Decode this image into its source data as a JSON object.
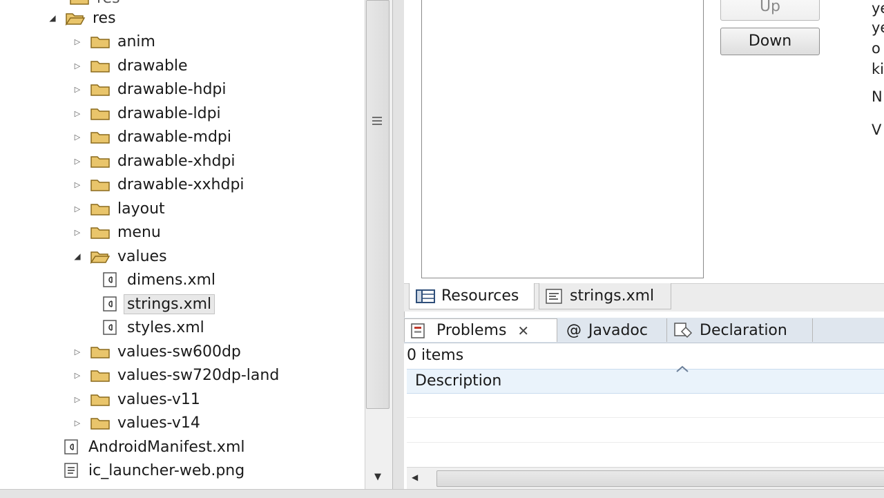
{
  "explorer": {
    "top_partial_label": "res",
    "items": [
      {
        "label": "res",
        "kind": "folder",
        "state": "open"
      },
      {
        "label": "anim",
        "kind": "folder",
        "state": "closed"
      },
      {
        "label": "drawable",
        "kind": "folder",
        "state": "closed"
      },
      {
        "label": "drawable-hdpi",
        "kind": "folder",
        "state": "closed"
      },
      {
        "label": "drawable-ldpi",
        "kind": "folder",
        "state": "closed"
      },
      {
        "label": "drawable-mdpi",
        "kind": "folder",
        "state": "closed"
      },
      {
        "label": "drawable-xhdpi",
        "kind": "folder",
        "state": "closed"
      },
      {
        "label": "drawable-xxhdpi",
        "kind": "folder",
        "state": "closed"
      },
      {
        "label": "layout",
        "kind": "folder",
        "state": "closed"
      },
      {
        "label": "menu",
        "kind": "folder",
        "state": "closed"
      },
      {
        "label": "values",
        "kind": "folder",
        "state": "open"
      },
      {
        "label": "dimens.xml",
        "kind": "xml"
      },
      {
        "label": "strings.xml",
        "kind": "xml",
        "selected": true
      },
      {
        "label": "styles.xml",
        "kind": "xml"
      },
      {
        "label": "values-sw600dp",
        "kind": "folder",
        "state": "closed"
      },
      {
        "label": "values-sw720dp-land",
        "kind": "folder",
        "state": "closed"
      },
      {
        "label": "values-v11",
        "kind": "folder",
        "state": "closed"
      },
      {
        "label": "values-v14",
        "kind": "folder",
        "state": "closed"
      },
      {
        "label": "AndroidManifest.xml",
        "kind": "xml"
      },
      {
        "label": "ic_launcher-web.png",
        "kind": "file"
      }
    ]
  },
  "editor": {
    "up_button": "Up",
    "down_button": "Down",
    "cut_text": [
      "ye",
      "ye",
      "o",
      "ki",
      "N",
      "V"
    ]
  },
  "editor_tabs": {
    "resources": "Resources",
    "strings": "strings.xml"
  },
  "problems": {
    "tabs": {
      "problems": "Problems",
      "javadoc": "Javadoc",
      "declaration": "Declaration"
    },
    "summary": "0 items",
    "column_description": "Description"
  },
  "colors": {
    "folder": "#e9c56b",
    "folder_outline": "#8a6a1c",
    "tab_strip": "#dfe6ee",
    "table_header": "#eaf3fb"
  }
}
